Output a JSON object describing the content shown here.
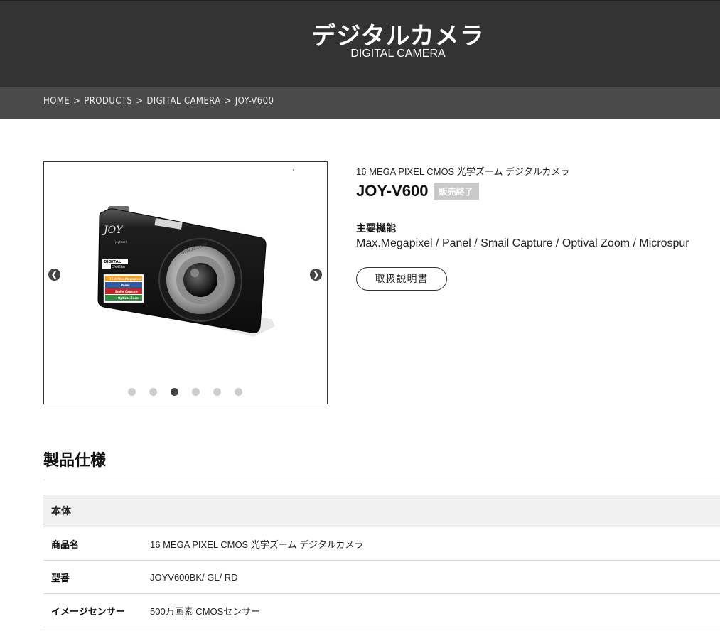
{
  "header": {
    "title": "デジタルカメラ",
    "subtitle": "DIGITAL CAMERA"
  },
  "breadcrumb": {
    "items": [
      "HOME",
      "PRODUCTS",
      "DIGITAL CAMERA",
      "JOY-V600"
    ],
    "separator": ">"
  },
  "gallery": {
    "slide_count": 6,
    "active_slide": 3,
    "camera_labels": {
      "brand": "JOY",
      "brand_sub": "joytouch",
      "badge_line1": "DIGITAL",
      "badge_line2": "CAMERA",
      "features": [
        "16.0 Max.Megapixel",
        "Panel",
        "Smile Capture",
        "Optical Zoom"
      ],
      "lens_ring": "OPTICAL ZOOM"
    }
  },
  "product": {
    "subtitle": "16 MEGA PIXEL CMOS 光学ズーム デジタルカメラ",
    "model": "JOY-V600",
    "status_badge": "販売終了",
    "features_heading": "主要機能",
    "features_text": "Max.Megapixel / Panel / Smail Capture / Optival Zoom / Microspur",
    "manual_button": "取扱説明書"
  },
  "specs": {
    "heading": "製品仕様",
    "section": "本体",
    "rows": [
      {
        "label": "商品名",
        "value": "16 MEGA PIXEL CMOS 光学ズーム デジタルカメラ"
      },
      {
        "label": "型番",
        "value": "JOYV600BK/ GL/ RD"
      },
      {
        "label": "イメージセンサー",
        "value": "500万画素 CMOSセンサー"
      }
    ]
  },
  "colors": {
    "header_bg": "#333333",
    "breadcrumb_bg": "#4a4a4a",
    "badge_bg": "#c9c9c9",
    "dot_active": "#444444",
    "dot_inactive": "#cccccc"
  }
}
